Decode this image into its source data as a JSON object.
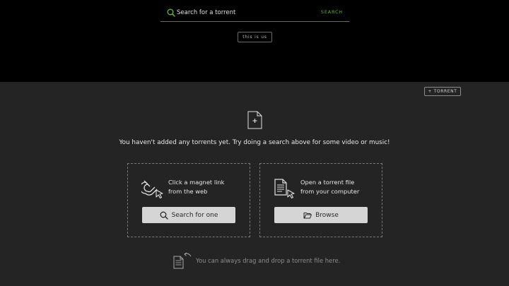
{
  "search": {
    "placeholder": "Search for a torrent",
    "button_label": "SEARCH",
    "icon": "search-icon"
  },
  "header": {
    "tag_label": "this is us"
  },
  "toolbar": {
    "add_torrent_label": "+ TORRENT"
  },
  "empty_state": {
    "icon": "file-plus-icon",
    "message": "You haven't added any torrents yet. Try doing a search above for some video or music!"
  },
  "cards": {
    "magnet": {
      "icon": "magnet-cursor-icon",
      "line1": "Click a magnet link",
      "line2": "from the web",
      "button_label": "Search for one",
      "button_icon": "search-icon"
    },
    "file": {
      "icon": "document-cursor-icon",
      "line1": "Open a torrent file",
      "line2": "from your computer",
      "button_label": "Browse",
      "button_icon": "folder-open-icon"
    }
  },
  "drop_hint": {
    "icon": "document-drop-icon",
    "text": "You can always drag and drop a torrent file here."
  },
  "colors": {
    "top_background": "#000000",
    "main_background": "#242424",
    "accent_green": "#5fb33f",
    "button_background": "#d5d5d5"
  }
}
